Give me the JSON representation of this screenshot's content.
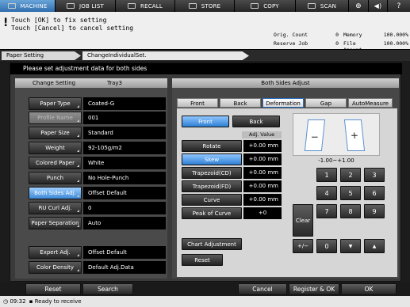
{
  "topbar": {
    "tabs": [
      {
        "label": "MACHINE",
        "icon": "machine-icon"
      },
      {
        "label": "JOB LIST",
        "icon": "joblist-icon"
      },
      {
        "label": "RECALL",
        "icon": "recall-icon"
      },
      {
        "label": "STORE",
        "icon": "store-icon"
      },
      {
        "label": "COPY",
        "icon": "copy-icon"
      },
      {
        "label": "SCAN",
        "icon": "scan-icon"
      }
    ]
  },
  "message": {
    "icon": "!",
    "line1": "Touch [OK] to fix setting",
    "line2": "Touch [Cancel] to cancel setting"
  },
  "counters": {
    "orig_count_label": "Orig. Count",
    "orig_count_value": "0",
    "reserve_job_label": "Reserve Job",
    "reserve_job_value": "0",
    "memory_label": "Memory",
    "memory_value": "100.000%",
    "file_amount_label": "File Amount",
    "file_amount_value": "100.000%"
  },
  "breadcrumb": {
    "item1": "Paper Setting",
    "item2": "ChangeIndividualSet."
  },
  "dialog": {
    "instruction": "Please set adjustment data for both sides",
    "left_header": "Change Setting",
    "tray": "Tray3",
    "rows": [
      {
        "label": "Paper Type",
        "value": "Coated-G"
      },
      {
        "label": "Profile Name",
        "value": "001"
      },
      {
        "label": "Paper Size",
        "value": "Standard"
      },
      {
        "label": "Weight",
        "value": "92-105g/m2"
      },
      {
        "label": "Colored Paper",
        "value": "White"
      },
      {
        "label": "Punch",
        "value": "No Hole-Punch"
      },
      {
        "label": "Both Sides Adj.",
        "value": "Offset Default"
      },
      {
        "label": "RU Curl Adj.",
        "value": "0"
      },
      {
        "label": "Paper Separation",
        "value": "Auto"
      }
    ],
    "bottom_rows": [
      {
        "label": "Expert Adj.",
        "value": "Offset Default"
      },
      {
        "label": "Color Density",
        "value": "Default Adj.Data"
      }
    ],
    "right_header": "Both Sides Adjust",
    "tabs": [
      "Front",
      "Back",
      "Deformation",
      "Gap",
      "AutoMeasure"
    ],
    "front_label": "Front",
    "back_label": "Back",
    "adj_value_header": "Adj. Value",
    "params": [
      {
        "label": "Rotate",
        "value": "+0.00 mm"
      },
      {
        "label": "Skew",
        "value": "+0.00 mm"
      },
      {
        "label": "Trapezoid(CD)",
        "value": "+0.00 mm"
      },
      {
        "label": "Trapezoid(FD)",
        "value": "+0.00 mm"
      },
      {
        "label": "Curve",
        "value": "+0.00 mm"
      },
      {
        "label": "Peak of Curve",
        "value": "+0"
      }
    ],
    "range": "-1.00~+1.00",
    "minus": "−",
    "plus": "+",
    "chart_adjustment": "Chart Adjustment",
    "reset_small": "Reset",
    "keypad": {
      "k1": "1",
      "k2": "2",
      "k3": "3",
      "k4": "4",
      "k5": "5",
      "k6": "6",
      "clear": "Clear",
      "k7": "7",
      "k8": "8",
      "k9": "9",
      "plusminus": "+/−",
      "k0": "0",
      "down": "▼",
      "up": "▲"
    }
  },
  "bottom": {
    "reset": "Reset",
    "search": "Search",
    "cancel": "Cancel",
    "register_ok": "Register & OK",
    "ok": "OK"
  },
  "status": {
    "time": "09:32",
    "text": "Ready to receive"
  }
}
